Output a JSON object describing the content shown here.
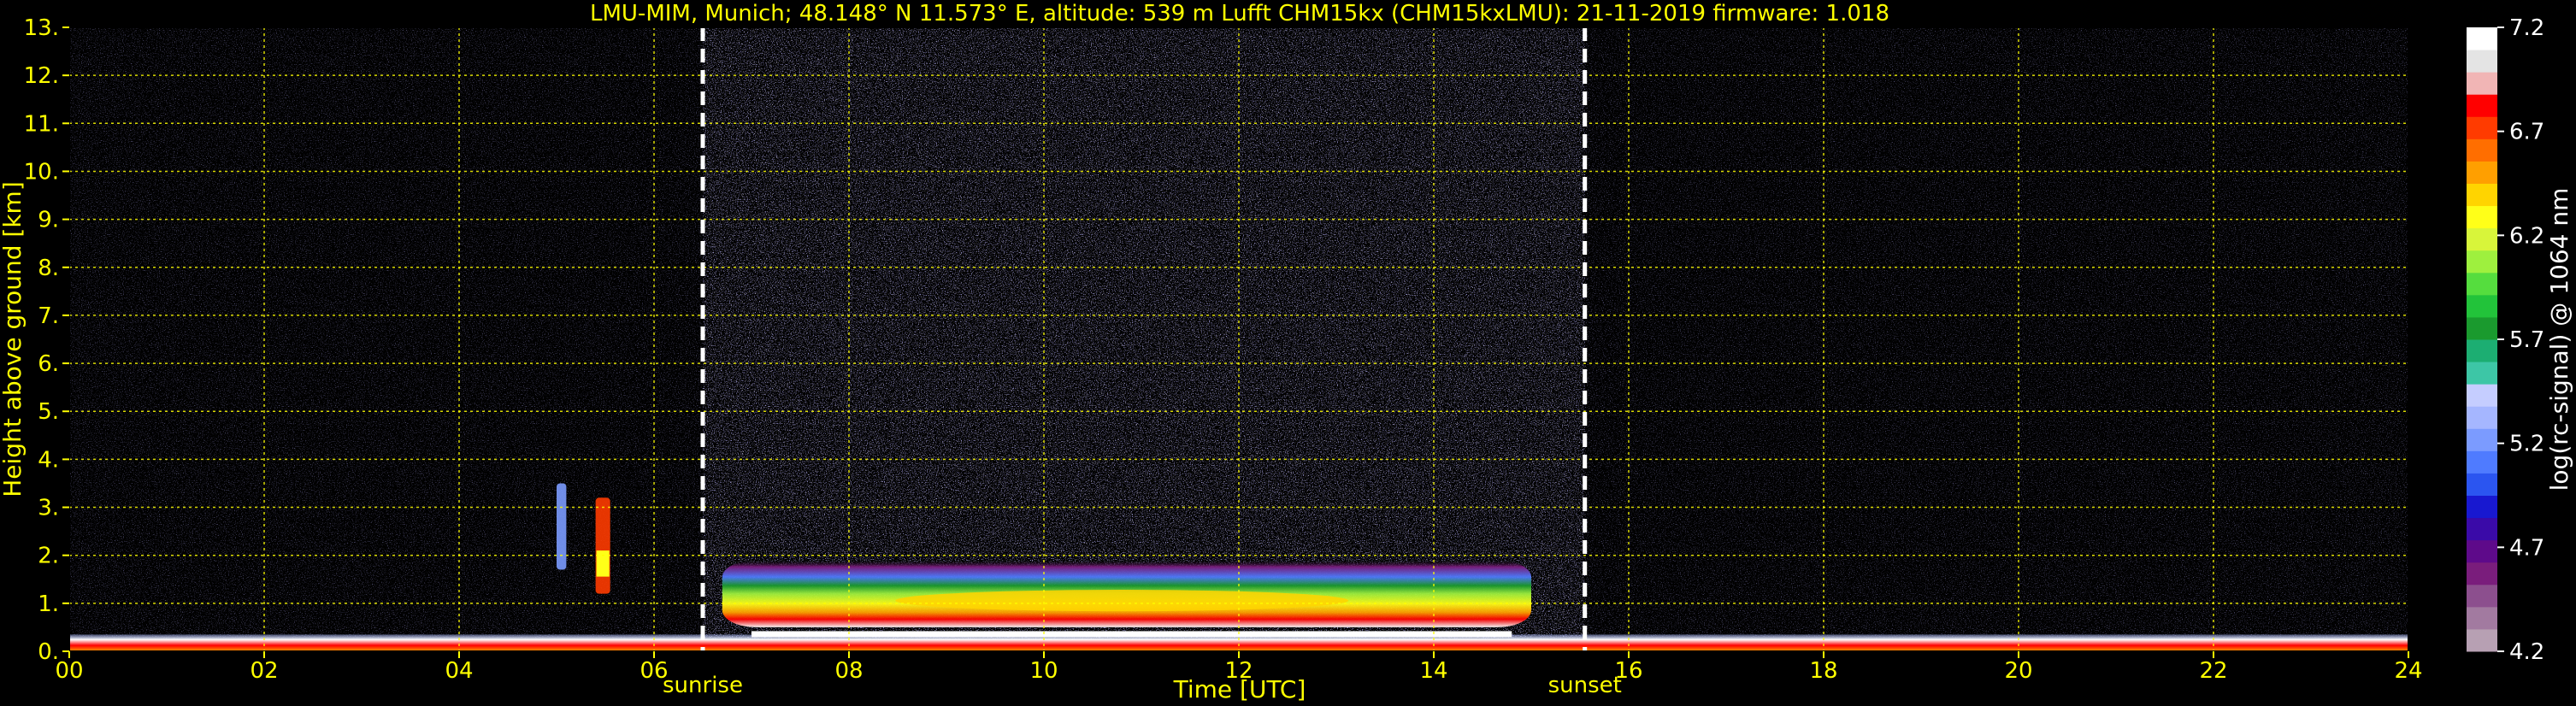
{
  "chart_data": {
    "type": "heatmap",
    "title": "LMU-MIM, Munich; 48.148° N 11.573° E, altitude: 539 m    Lufft CHM15kx (CHM15kxLMU): 21-11-2019    firmware: 1.018",
    "xlabel": "Time [UTC]",
    "ylabel": "Height above ground [km]",
    "xlim": [
      0,
      24
    ],
    "ylim": [
      0,
      13
    ],
    "x_ticks": [
      "00",
      "02",
      "04",
      "06",
      "08",
      "10",
      "12",
      "14",
      "16",
      "18",
      "20",
      "22",
      "24"
    ],
    "y_ticks": [
      "0.",
      "1.",
      "2.",
      "3.",
      "4.",
      "5.",
      "6.",
      "7.",
      "8.",
      "9.",
      "10.",
      "11.",
      "12.",
      "13."
    ],
    "grid": true,
    "grid_color": "#ffff00",
    "events": [
      {
        "label": "sunrise",
        "time": 6.5
      },
      {
        "label": "sunset",
        "time": 15.55
      }
    ],
    "colorbar": {
      "label": "log(rc-signal) @ 1064 nm",
      "range": [
        4.2,
        7.2
      ],
      "ticks": [
        "4.2",
        "4.7",
        "5.2",
        "5.7",
        "6.2",
        "6.7",
        "7.2"
      ],
      "colors": [
        "#b7a0b3",
        "#a27aa0",
        "#8c4f8e",
        "#7a1d7c",
        "#5e0a8a",
        "#3a0aa8",
        "#1818d0",
        "#2b55f0",
        "#4f7bff",
        "#7b9bff",
        "#a5b6ff",
        "#c5cdff",
        "#3dc6a6",
        "#1cae72",
        "#1a9a2e",
        "#22c33a",
        "#55dd3e",
        "#9ef03e",
        "#d8f53a",
        "#ffff18",
        "#ffd400",
        "#ff9f00",
        "#ff6e00",
        "#ff3b00",
        "#ff0000",
        "#f1b5b5",
        "#e4e4e4",
        "#ffffff"
      ]
    },
    "layers": [
      {
        "name": "near-surface",
        "start": 0,
        "end": 24,
        "base_km": 0.0,
        "top_km": 0.35,
        "level": 6.8
      },
      {
        "name": "boundary-layer-aerosol",
        "start": 6.7,
        "end": 15.0,
        "base_km": 0.5,
        "top_km": 1.9,
        "level": 5.9
      },
      {
        "name": "cloud",
        "start": 5.4,
        "end": 5.55,
        "base_km": 1.2,
        "top_km": 3.2,
        "level": 6.3
      },
      {
        "name": "cloud",
        "start": 5.0,
        "end": 5.1,
        "base_km": 1.7,
        "top_km": 3.5,
        "level": 5.3
      }
    ]
  }
}
